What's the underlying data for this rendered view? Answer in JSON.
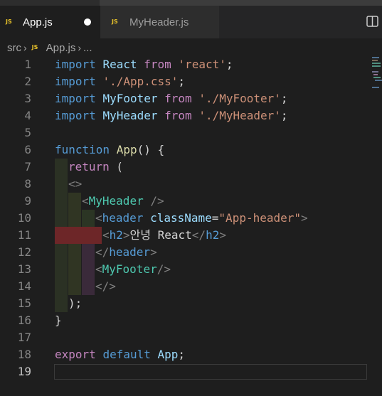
{
  "tabs": [
    {
      "label": "App.js",
      "icon": "JS",
      "active": true,
      "modified": true
    },
    {
      "label": "MyHeader.js",
      "icon": "JS",
      "active": false,
      "modified": false
    }
  ],
  "breadcrumb": {
    "folder": "src",
    "file": "App.js",
    "more": "..."
  },
  "editor": {
    "current_line": 19,
    "lines": [
      {
        "n": "1",
        "t": [
          "import",
          " ",
          "React",
          " ",
          "from",
          " ",
          "'react'",
          ";"
        ]
      },
      {
        "n": "2",
        "t": [
          "import",
          " ",
          "'./App.css'",
          ";"
        ]
      },
      {
        "n": "3",
        "t": [
          "import",
          " ",
          "MyFooter",
          " ",
          "from",
          " ",
          "'./MyFooter'",
          ";"
        ]
      },
      {
        "n": "4",
        "t": [
          "import",
          " ",
          "MyHeader",
          " ",
          "from",
          " ",
          "'./MyHeader'",
          ";"
        ]
      },
      {
        "n": "5",
        "t": []
      },
      {
        "n": "6",
        "t": [
          "function",
          " ",
          "App",
          "() {"
        ]
      },
      {
        "n": "7",
        "t": [
          "return",
          " ("
        ]
      },
      {
        "n": "8",
        "t": [
          "<>"
        ]
      },
      {
        "n": "9",
        "t": [
          "<",
          "MyHeader",
          " />"
        ]
      },
      {
        "n": "10",
        "t": [
          "<",
          "header",
          " ",
          "className",
          "=",
          "\"App-header\"",
          ">"
        ]
      },
      {
        "n": "11",
        "t": [
          "<",
          "h2",
          ">",
          "안녕 React",
          "</",
          "h2",
          ">"
        ]
      },
      {
        "n": "12",
        "t": [
          "</",
          "header",
          ">"
        ]
      },
      {
        "n": "13",
        "t": [
          "<",
          "MyFooter",
          "/>"
        ]
      },
      {
        "n": "14",
        "t": [
          "</>"
        ]
      },
      {
        "n": "15",
        "t": [
          ");"
        ]
      },
      {
        "n": "16",
        "t": [
          "}"
        ]
      },
      {
        "n": "17",
        "t": []
      },
      {
        "n": "18",
        "t": [
          "export",
          " ",
          "default",
          " ",
          "App",
          ";"
        ]
      },
      {
        "n": "19",
        "t": []
      }
    ]
  },
  "colors": {
    "keyword": "#569cd6",
    "control": "#c586c0",
    "string": "#ce9178",
    "identifier": "#9cdcfe",
    "function": "#dcdcaa",
    "component": "#4ec9b0",
    "punct": "#808080",
    "text": "#d4d4d4",
    "js_icon": "#e8c22a"
  }
}
